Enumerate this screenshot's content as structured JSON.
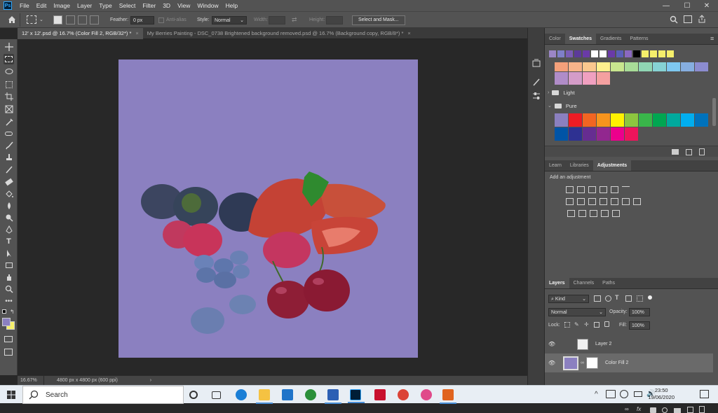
{
  "app": {
    "logo": "Ps"
  },
  "menu": [
    "File",
    "Edit",
    "Image",
    "Layer",
    "Type",
    "Select",
    "Filter",
    "3D",
    "View",
    "Window",
    "Help"
  ],
  "window_controls": {
    "minimize": "—",
    "maximize": "☐",
    "close": "✕"
  },
  "options_bar": {
    "feather_label": "Feather:",
    "feather_value": "0 px",
    "anti_alias_label": "Anti-alias",
    "style_label": "Style:",
    "style_value": "Normal",
    "width_label": "Width:",
    "height_label": "Height:",
    "select_mask_label": "Select and Mask..."
  },
  "tabs": [
    {
      "label": "12' x 12'.psd @ 16.7% (Color Fill 2, RGB/32*) *",
      "active": true
    },
    {
      "label": "My Berries Painting - DSC_0738 Brightened background removed.psd @ 16.7% (Background copy, RGB/8*) *",
      "active": false
    }
  ],
  "tab_close": "×",
  "canvas": {
    "background_color": "#8b80c0"
  },
  "status": {
    "zoom": "16.67%",
    "doc_info": "4800 px x 4800 px (600 ppi)",
    "arrow": "›"
  },
  "swatches_panel": {
    "tabs": [
      "Color",
      "Swatches",
      "Gradients",
      "Patterns"
    ],
    "active_tab": "Swatches",
    "recent_colors": [
      "#9b86c6",
      "#7f7fc8",
      "#7a5cb5",
      "#5c3a9a",
      "#6a3aa8",
      "#ffffff",
      "#ffffff",
      "#6a3aa8",
      "#5b5fb8",
      "#8a68c0",
      "#000000",
      "#f5ef6b",
      "#f5ef6b",
      "#f5ef6b",
      "#f5ef6b"
    ],
    "pastel_row1": [
      "#f4a07a",
      "#f8b48a",
      "#fbc88e",
      "#fff08e",
      "#c8e68e",
      "#a8dc98",
      "#90d6b4",
      "#86d2d4",
      "#7ec8f0",
      "#86aee0",
      "#8c8cd0"
    ],
    "pastel_row2": [
      "#b08cc8",
      "#d49cc8",
      "#f0a0c0",
      "#f4a0a0"
    ],
    "group_light": "Light",
    "group_pure": "Pure",
    "pure_row1": [
      "#8b80c0",
      "#ed1c24",
      "#f26522",
      "#f7941d",
      "#fff200",
      "#8dc63f",
      "#39b54a",
      "#00a651",
      "#00a99d",
      "#00aeef",
      "#0072bc"
    ],
    "pure_row2": [
      "#0054a6",
      "#2e3192",
      "#662d91",
      "#92278f",
      "#ec008c",
      "#ed145b"
    ]
  },
  "adjustments_panel": {
    "tabs": [
      "Learn",
      "Libraries",
      "Adjustments"
    ],
    "active_tab": "Adjustments",
    "hint": "Add an adjustment"
  },
  "layers_panel": {
    "tabs": [
      "Layers",
      "Channels",
      "Paths"
    ],
    "active_tab": "Layers",
    "kind_label": "Kind",
    "blend_mode": "Normal",
    "opacity_label": "Opacity:",
    "opacity_value": "100%",
    "lock_label": "Lock:",
    "fill_label": "Fill:",
    "fill_value": "100%",
    "layers": [
      {
        "name": "Layer 2",
        "selected": false
      },
      {
        "name": "Color Fill 2",
        "selected": true
      }
    ],
    "fx_label": "fx"
  },
  "taskbar": {
    "search_placeholder": "Search",
    "time": "23:50",
    "date": "19/06/2020"
  },
  "colors": {
    "foreground": "#8b80c0",
    "background": "#f5ef6b"
  }
}
